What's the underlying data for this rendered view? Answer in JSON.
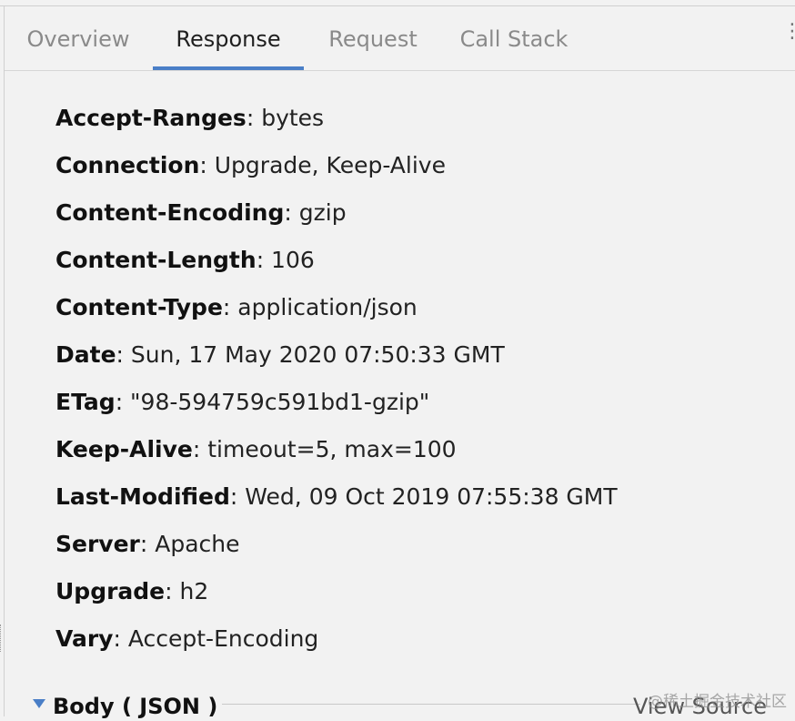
{
  "tabs": {
    "overview": "Overview",
    "response": "Response",
    "request": "Request",
    "call_stack": "Call Stack",
    "active": "Response"
  },
  "more_icon": "vertical-ellipsis-icon",
  "headers": [
    {
      "name": "Accept-Ranges",
      "value": ": bytes"
    },
    {
      "name": "Connection",
      "value": ": Upgrade, Keep-Alive"
    },
    {
      "name": "Content-Encoding",
      "value": ": gzip"
    },
    {
      "name": "Content-Length",
      "value": ": 106"
    },
    {
      "name": "Content-Type",
      "value": ": application/json"
    },
    {
      "name": "Date",
      "value": ": Sun, 17 May 2020 07:50:33 GMT"
    },
    {
      "name": "ETag",
      "value": ": \"98-594759c591bd1-gzip\""
    },
    {
      "name": "Keep-Alive",
      "value": ": timeout=5, max=100"
    },
    {
      "name": "Last-Modified",
      "value": ": Wed, 09 Oct 2019 07:55:38 GMT"
    },
    {
      "name": "Server",
      "value": ": Apache"
    },
    {
      "name": "Upgrade",
      "value": ": h2"
    },
    {
      "name": "Vary",
      "value": ": Accept-Encoding"
    }
  ],
  "body_section": {
    "title": "Body ( JSON )",
    "view_source": "View Source",
    "collapse_icon": "triangle-down-icon"
  },
  "watermark": "@稀土掘金技术社区",
  "colors": {
    "accent": "#4a7fc7",
    "background": "#f2f2f2"
  }
}
